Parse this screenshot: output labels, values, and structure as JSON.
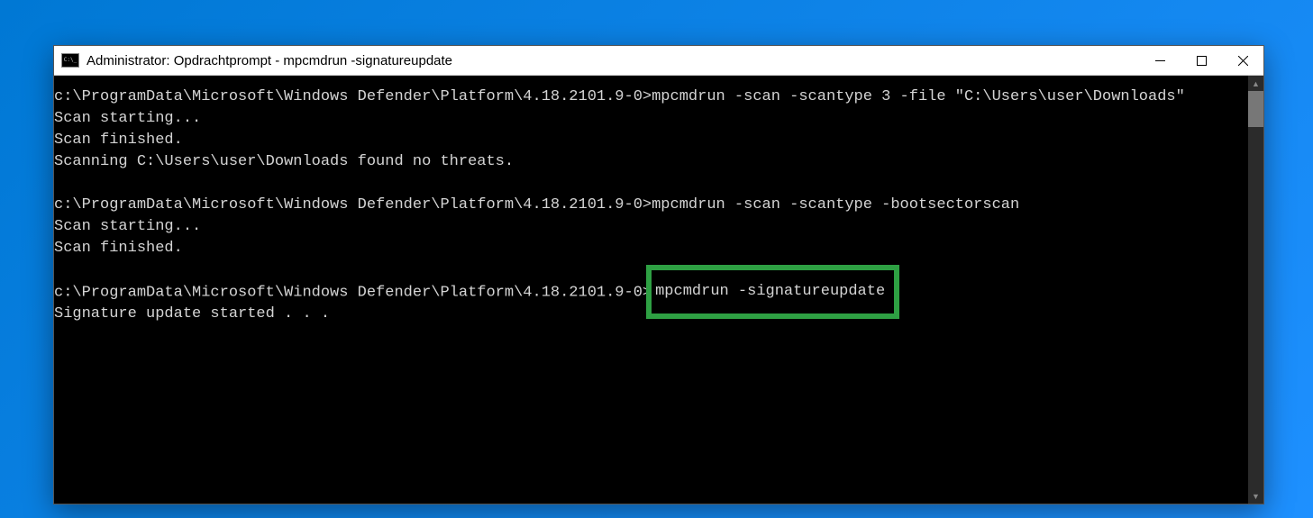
{
  "window": {
    "title": "Administrator: Opdrachtprompt - mpcmdrun  -signatureupdate"
  },
  "scrollbar": {
    "up_glyph": "▲",
    "down_glyph": "▼"
  },
  "console": {
    "prompt_path": "c:\\ProgramData\\Microsoft\\Windows Defender\\Platform\\4.18.2101.9-0>",
    "cmd1": "mpcmdrun -scan -scantype 3 -file \"C:\\Users\\user\\Downloads\"",
    "out1a": "Scan starting...",
    "out1b": "Scan finished.",
    "out1c": "Scanning C:\\Users\\user\\Downloads found no threats.",
    "cmd2": "mpcmdrun -scan -scantype -bootsectorscan",
    "out2a": "Scan starting...",
    "out2b": "Scan finished.",
    "cmd3": "mpcmdrun -signatureupdate",
    "out3a": "Signature update started . . ."
  }
}
